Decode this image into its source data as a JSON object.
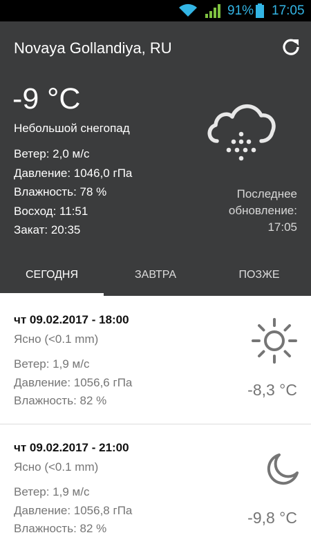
{
  "status_bar": {
    "battery_percent": "91%",
    "time": "17:05",
    "icons": [
      "wifi-icon",
      "signal-icon",
      "battery-icon"
    ],
    "color": "#33b5e5"
  },
  "header": {
    "location": "Novaya Gollandiya, RU",
    "temperature": "-9 °C",
    "description": "Небольшой снегопад",
    "wind": "Ветер: 2,0 м/с",
    "pressure": "Давление: 1046,0 гПа",
    "humidity": "Влажность: 78 %",
    "sunrise": "Восход: 11:51",
    "sunset": "Закат: 20:35",
    "last_update_line1": "Последнее",
    "last_update_line2": "обновление:",
    "last_update_time": "17:05",
    "weather_icon": "snow-cloud-icon",
    "refresh_icon": "refresh-icon",
    "background": "#3b3c3d"
  },
  "tabs": [
    {
      "label": "СЕГОДНЯ",
      "active": true
    },
    {
      "label": "ЗАВТРА",
      "active": false
    },
    {
      "label": "ПОЗЖЕ",
      "active": false
    }
  ],
  "forecast": [
    {
      "datetime": "чт 09.02.2017 - 18:00",
      "condition": "Ясно (<0.1 mm)",
      "wind": "Ветер: 1,9 м/с",
      "pressure": "Давление: 1056,6 гПа",
      "humidity": "Влажность: 82 %",
      "temperature": "-8,3 °C",
      "icon": "sun-icon"
    },
    {
      "datetime": "чт 09.02.2017 - 21:00",
      "condition": "Ясно (<0.1 mm)",
      "wind": "Ветер: 1,9 м/с",
      "pressure": "Давление: 1056,8 гПа",
      "humidity": "Влажность: 82 %",
      "temperature": "-9,8 °C",
      "icon": "moon-icon"
    }
  ]
}
